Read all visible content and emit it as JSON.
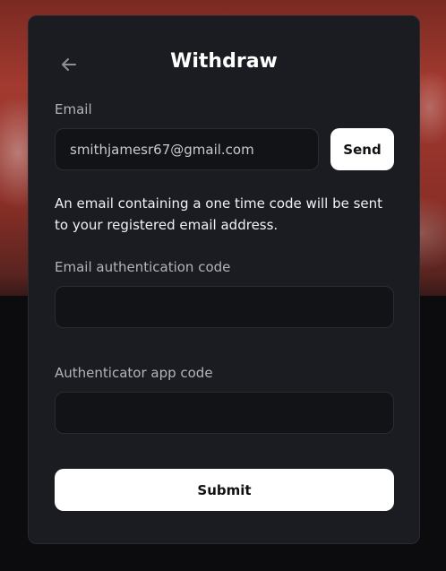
{
  "header": {
    "title": "Withdraw",
    "back_icon": "arrow-left-icon"
  },
  "email": {
    "label": "Email",
    "value": "smithjamesr67@gmail.com",
    "send_label": "Send"
  },
  "note": "An email containing a one time code will be sent to your registered email address.",
  "email_code": {
    "label": "Email authentication code",
    "value": ""
  },
  "app_code": {
    "label": "Authenticator app code",
    "value": ""
  },
  "submit_label": "Submit",
  "colors": {
    "panel": "#1b1c21",
    "input_bg": "#121317",
    "button_bg": "#ffffff"
  }
}
